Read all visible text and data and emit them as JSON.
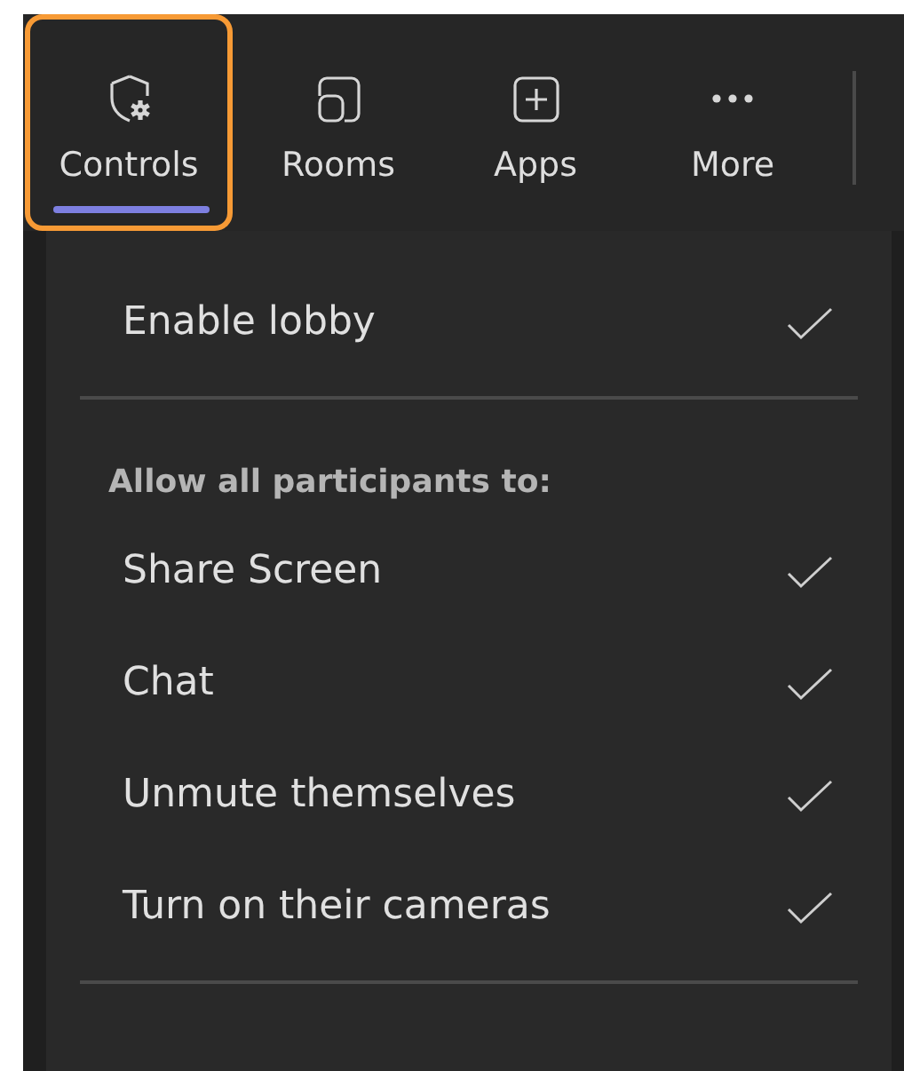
{
  "toolbar": {
    "tabs": [
      {
        "label": "Controls",
        "kind": "shield-gear",
        "selected": true,
        "highlighted": true
      },
      {
        "label": "Rooms",
        "kind": "rooms",
        "selected": false,
        "highlighted": false
      },
      {
        "label": "Apps",
        "kind": "plus-square",
        "selected": false,
        "highlighted": false
      },
      {
        "label": "More",
        "kind": "dots",
        "selected": false,
        "highlighted": false
      }
    ]
  },
  "menu": {
    "sections": [
      {
        "items": [
          {
            "label": "Enable lobby",
            "checked": true
          }
        ]
      },
      {
        "header": "Allow all participants to:",
        "items": [
          {
            "label": "Share Screen",
            "checked": true
          },
          {
            "label": "Chat",
            "checked": true
          },
          {
            "label": "Unmute themselves",
            "checked": true
          },
          {
            "label": "Turn on their cameras",
            "checked": true
          }
        ]
      }
    ]
  }
}
